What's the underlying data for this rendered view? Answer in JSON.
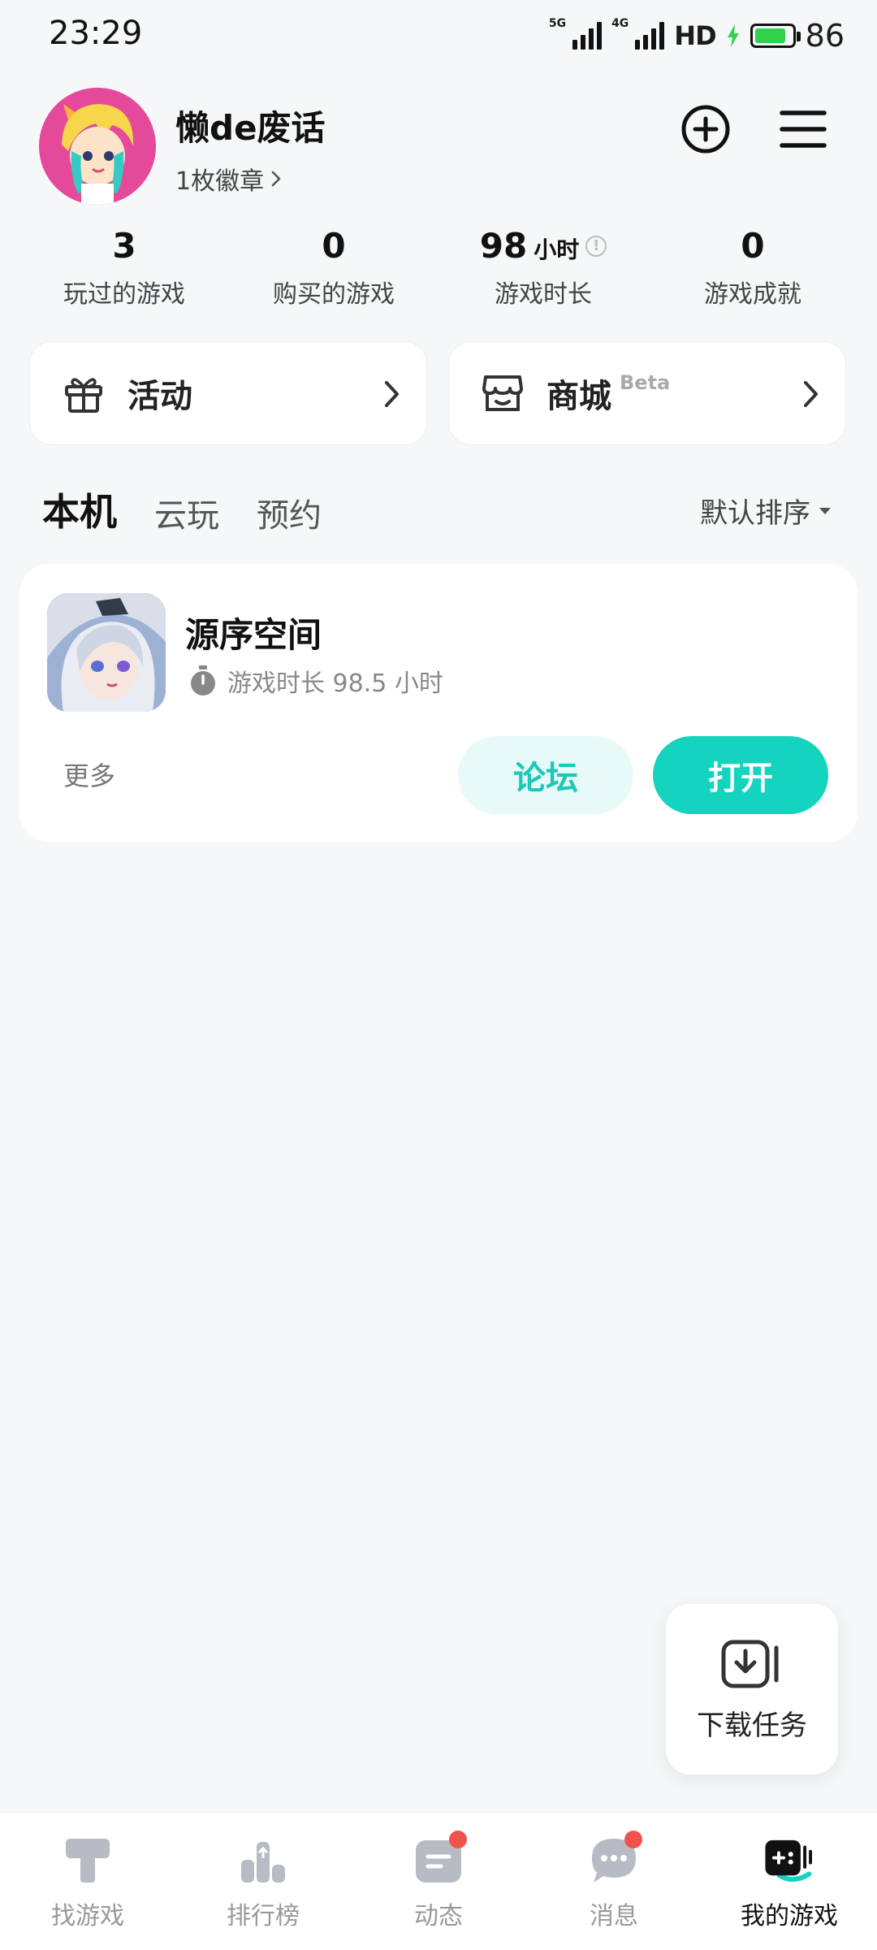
{
  "status_bar": {
    "time": "23:29",
    "net1": "5G",
    "net2": "4G",
    "hd": "HD",
    "battery": "86"
  },
  "profile": {
    "username": "懒de废话",
    "badges": "1枚徽章"
  },
  "stats": [
    {
      "value": "3",
      "unit": "",
      "label": "玩过的游戏"
    },
    {
      "value": "0",
      "unit": "",
      "label": "购买的游戏"
    },
    {
      "value": "98",
      "unit": "小时",
      "label": "游戏时长"
    },
    {
      "value": "0",
      "unit": "",
      "label": "游戏成就"
    }
  ],
  "quick_cards": {
    "activity": "活动",
    "store": "商城",
    "store_badge": "Beta"
  },
  "tabs": [
    {
      "label": "本机",
      "active": true
    },
    {
      "label": "云玩",
      "active": false
    },
    {
      "label": "预约",
      "active": false
    }
  ],
  "sort_label": "默认排序",
  "game": {
    "name": "源序空间",
    "playtime": "游戏时长 98.5 小时",
    "more": "更多",
    "forum": "论坛",
    "open": "打开"
  },
  "download_task": "下载任务",
  "bottom_nav": [
    {
      "label": "找游戏",
      "icon": "find-game-icon"
    },
    {
      "label": "排行榜",
      "icon": "ranking-icon"
    },
    {
      "label": "动态",
      "icon": "feed-icon"
    },
    {
      "label": "消息",
      "icon": "message-icon"
    },
    {
      "label": "我的游戏",
      "icon": "my-games-icon"
    }
  ],
  "colors": {
    "accent": "#14d3bf",
    "notification": "#f2524c",
    "avatar_bg": "#e5499a"
  }
}
